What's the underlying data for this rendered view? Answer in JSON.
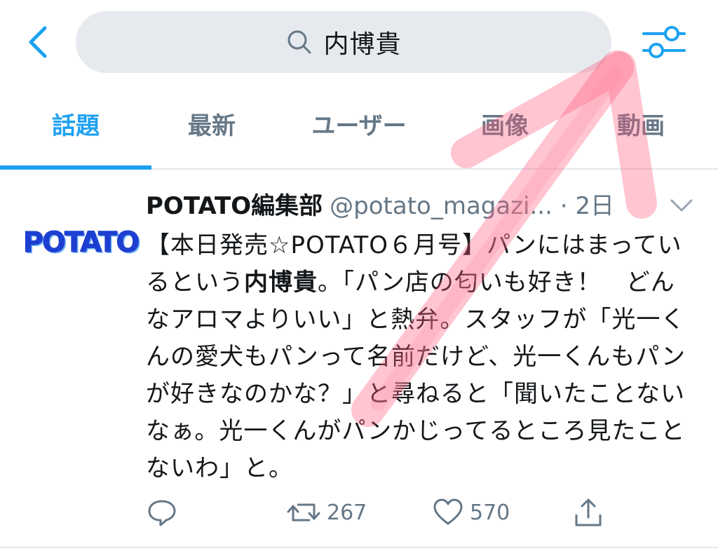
{
  "search": {
    "query": "内博貴"
  },
  "tabs": [
    {
      "label": "話題",
      "active": true
    },
    {
      "label": "最新",
      "active": false
    },
    {
      "label": "ユーザー",
      "active": false
    },
    {
      "label": "画像",
      "active": false
    },
    {
      "label": "動画",
      "active": false
    }
  ],
  "tweet": {
    "avatar_text": "POTATO",
    "author_name": "POTATO編集部",
    "author_handle": "@potato_magazi...",
    "time": "· 2日",
    "body": {
      "part1": "【本日発売☆POTATO６月号】パンにはまっているという",
      "highlight": "内博貴",
      "part2": "。「パン店の匂いも好き！　どんなアロマよりいい」と熱弁。スタッフが「光一くんの愛犬もパンって名前だけど、光一くんもパンが好きなのかな？」と尋ねると「聞いたことないなぁ。光一くんがパンかじってるところ見たことないわ」と。"
    },
    "actions": {
      "retweets": "267",
      "likes": "570"
    }
  },
  "colors": {
    "accent": "#1da1f2",
    "muted": "#657786",
    "text": "#14171a",
    "search_bg": "#e6e9ed",
    "annotation": "#ff5a7a"
  }
}
